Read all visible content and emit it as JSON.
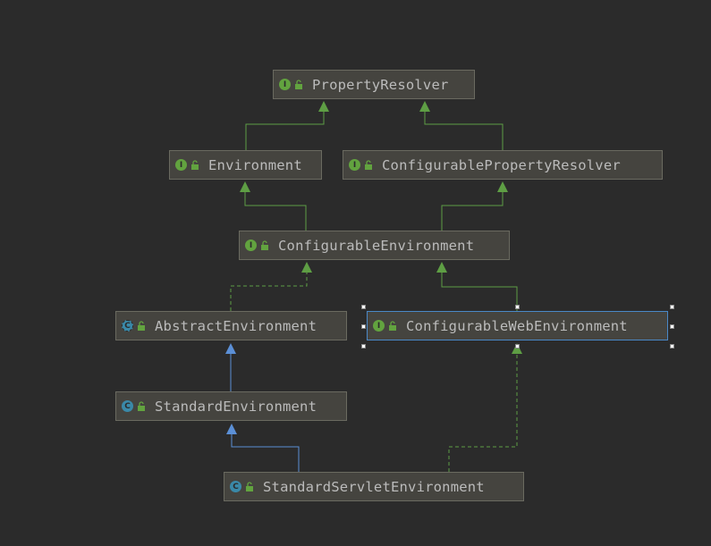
{
  "diagram": {
    "nodes": [
      {
        "id": "property-resolver",
        "label": "PropertyResolver",
        "kind": "I"
      },
      {
        "id": "environment",
        "label": "Environment",
        "kind": "I"
      },
      {
        "id": "configurable-property-resolver",
        "label": "ConfigurablePropertyResolver",
        "kind": "I"
      },
      {
        "id": "configurable-environment",
        "label": "ConfigurableEnvironment",
        "kind": "I"
      },
      {
        "id": "abstract-environment",
        "label": "AbstractEnvironment",
        "kind": "C"
      },
      {
        "id": "configurable-web-environment",
        "label": "ConfigurableWebEnvironment",
        "kind": "I"
      },
      {
        "id": "standard-environment",
        "label": "StandardEnvironment",
        "kind": "C"
      },
      {
        "id": "standard-servlet-environment",
        "label": "StandardServletEnvironment",
        "kind": "C"
      }
    ],
    "selected_node": "configurable-web-environment",
    "colors": {
      "background": "#2b2b2b",
      "interface_badge": "#62a33f",
      "class_badge": "#3a89a8",
      "extends_edge": "#5e9e44",
      "class_extends_edge": "#5b8fd6",
      "implements_edge": "#5e9e44",
      "selection": "#4a88c7"
    },
    "edges": [
      {
        "from": "environment",
        "to": "property-resolver",
        "type": "extends"
      },
      {
        "from": "configurable-property-resolver",
        "to": "property-resolver",
        "type": "extends"
      },
      {
        "from": "configurable-environment",
        "to": "environment",
        "type": "extends"
      },
      {
        "from": "configurable-environment",
        "to": "configurable-property-resolver",
        "type": "extends"
      },
      {
        "from": "abstract-environment",
        "to": "configurable-environment",
        "type": "implements"
      },
      {
        "from": "configurable-web-environment",
        "to": "configurable-environment",
        "type": "extends"
      },
      {
        "from": "standard-environment",
        "to": "abstract-environment",
        "type": "class-extends"
      },
      {
        "from": "standard-servlet-environment",
        "to": "standard-environment",
        "type": "class-extends"
      },
      {
        "from": "standard-servlet-environment",
        "to": "configurable-web-environment",
        "type": "implements"
      }
    ]
  }
}
